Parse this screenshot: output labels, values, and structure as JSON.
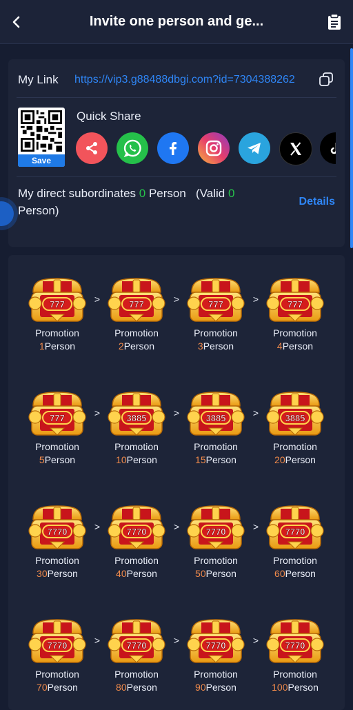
{
  "header": {
    "title": "Invite one person and ge..."
  },
  "share": {
    "my_link_label": "My Link",
    "my_link_url": "https://vip3.g88488dbgi.com?id=7304388262",
    "save_label": "Save",
    "quick_share_label": "Quick Share",
    "icons": [
      {
        "name": "share-icon",
        "color": "#f2545b"
      },
      {
        "name": "whatsapp-icon",
        "color": "#25c04a"
      },
      {
        "name": "facebook-icon",
        "color": "#1f77f2"
      },
      {
        "name": "instagram-icon",
        "color": "#d6367e"
      },
      {
        "name": "telegram-icon",
        "color": "#2aa4de"
      },
      {
        "name": "x-icon",
        "color": "#000000"
      },
      {
        "name": "tiktok-icon",
        "color": "#000000"
      }
    ]
  },
  "subordinates": {
    "prefix": "My direct subordinates",
    "count": "0",
    "unit": "Person",
    "valid_prefix": "(Valid",
    "valid_count": "0",
    "valid_suffix": "Person)",
    "details_label": "Details"
  },
  "rewards": {
    "label": "Promotion",
    "unit": "Person",
    "items": [
      {
        "count": "1",
        "chest_value": "777"
      },
      {
        "count": "2",
        "chest_value": "777"
      },
      {
        "count": "3",
        "chest_value": "777"
      },
      {
        "count": "4",
        "chest_value": "777"
      },
      {
        "count": "5",
        "chest_value": "777"
      },
      {
        "count": "10",
        "chest_value": "3885"
      },
      {
        "count": "15",
        "chest_value": "3885"
      },
      {
        "count": "20",
        "chest_value": "3885"
      },
      {
        "count": "30",
        "chest_value": "7770"
      },
      {
        "count": "40",
        "chest_value": "7770"
      },
      {
        "count": "50",
        "chest_value": "7770"
      },
      {
        "count": "60",
        "chest_value": "7770"
      },
      {
        "count": "70",
        "chest_value": "7770"
      },
      {
        "count": "80",
        "chest_value": "7770"
      },
      {
        "count": "90",
        "chest_value": "7770"
      },
      {
        "count": "100",
        "chest_value": "7770"
      }
    ],
    "arrow": ">"
  }
}
